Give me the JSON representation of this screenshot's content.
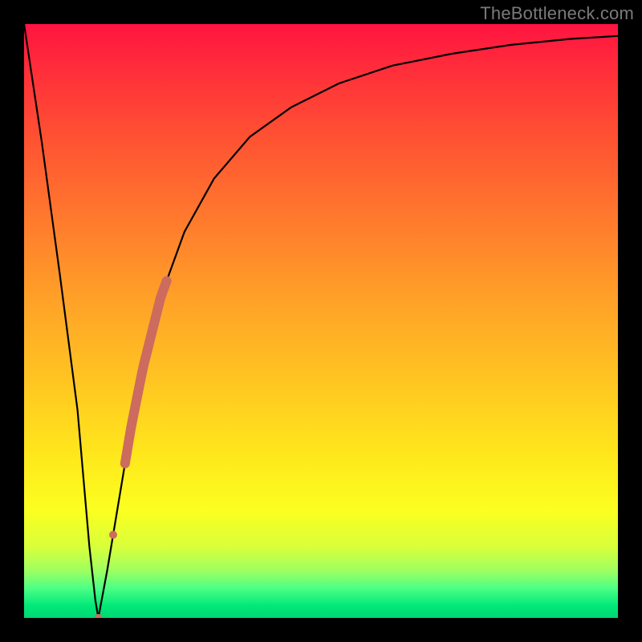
{
  "watermark": "TheBottleneck.com",
  "colors": {
    "frame": "#000000",
    "curve": "#000000",
    "marker": "#CC6B5E",
    "gradient_top": "#ff1440",
    "gradient_bottom": "#00d873"
  },
  "chart_data": {
    "type": "line",
    "title": "",
    "xlabel": "",
    "ylabel": "",
    "xlim": [
      0,
      100
    ],
    "ylim": [
      0,
      100
    ],
    "grid": false,
    "series": [
      {
        "name": "bottleneck-curve",
        "x": [
          0,
          3,
          6,
          9,
          11,
          12,
          12.5,
          14,
          16,
          18,
          20,
          23,
          27,
          32,
          38,
          45,
          53,
          62,
          72,
          82,
          92,
          100
        ],
        "values": [
          100,
          80,
          58,
          35,
          12,
          3,
          0,
          8,
          20,
          32,
          42,
          54,
          65,
          74,
          81,
          86,
          90,
          93,
          95,
          96.5,
          97.5,
          98
        ]
      }
    ],
    "markers": [
      {
        "name": "highlight-segment",
        "x_start": 17,
        "x_end": 24,
        "thickness": 12
      },
      {
        "name": "highlight-dot",
        "x": 15,
        "thickness": 10
      },
      {
        "name": "minimum-dot",
        "x": 12.5,
        "thickness": 10
      }
    ]
  }
}
